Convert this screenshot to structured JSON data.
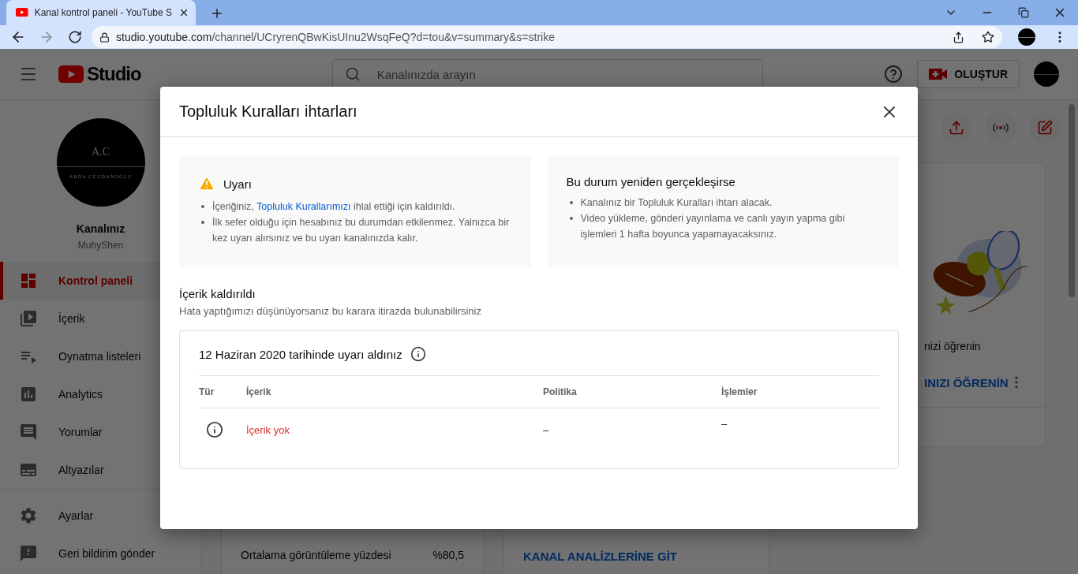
{
  "browser": {
    "tab_title": "Kanal kontrol paneli - YouTube S",
    "url_host": "studio.youtube.com",
    "url_path": "/channel/UCryrenQBwKisUInu2WsqFeQ?d=tou&v=summary&s=strike"
  },
  "header": {
    "logo_text": "Studio",
    "search_placeholder": "Kanalınızda arayın",
    "create_label": "OLUŞTUR"
  },
  "sidebar": {
    "avatar_initials": "A.C",
    "avatar_name": "ARDA CÜZDANOĞLU",
    "channel_label": "Kanalınız",
    "channel_name": "MuhyShen",
    "items": [
      {
        "label": "Kontrol paneli",
        "selected": true
      },
      {
        "label": "İçerik",
        "selected": false
      },
      {
        "label": "Oynatma listeleri",
        "selected": false
      },
      {
        "label": "Analytics",
        "selected": false
      },
      {
        "label": "Yorumlar",
        "selected": false
      },
      {
        "label": "Altyazılar",
        "selected": false
      }
    ],
    "footer_items": [
      {
        "label": "Ayarlar"
      },
      {
        "label": "Geri bildirim gönder"
      }
    ]
  },
  "dashboard": {
    "card_text": "nizi öğrenin",
    "card_action": "INIZI ÖĞRENİN",
    "stats": [
      {
        "label": "Ortalama görüntüleme yüzdesi",
        "value": "%80,5"
      }
    ],
    "analytics_link": "KANAL ANALİZLERİNE GİT"
  },
  "dialog": {
    "title": "Topluluk Kuralları ihtarları",
    "panels": [
      {
        "kind": "warning",
        "title": "Uyarı",
        "bullets": [
          {
            "text": "İçeriğiniz,",
            "link": "Topluluk Kurallarımızı",
            "after": "ihlal ettiği için kaldırıldı."
          },
          {
            "text": "İlk sefer olduğu için hesabınız bu durumdan etkilenmez. Yalnızca bir kez uyarı alırsınız ve bu uyarı kanalınızda kalır."
          }
        ]
      },
      {
        "kind": "plain",
        "title": "Bu durum yeniden gerçekleşirse",
        "bullets": [
          {
            "text": "Kanalınız bir Topluluk Kuralları ihtarı alacak."
          },
          {
            "text": "Video yükleme, gönderi yayınlama ve canlı yayın yapma gibi işlemleri 1 hafta boyunca yapamayacaksınız."
          }
        ]
      }
    ],
    "section_title": "İçerik kaldırıldı",
    "section_subtitle": "Hata yaptığımızı düşünüyorsanız bu karara itirazda bulunabilirsiniz",
    "strike": {
      "title": "12 Haziran 2020 tarihinde uyarı aldınız",
      "columns": [
        "Tür",
        "İçerik",
        "Politika",
        "İşlemler"
      ],
      "rows": [
        {
          "content": "İçerik yok",
          "policy": "–",
          "actions": "–"
        }
      ]
    }
  }
}
